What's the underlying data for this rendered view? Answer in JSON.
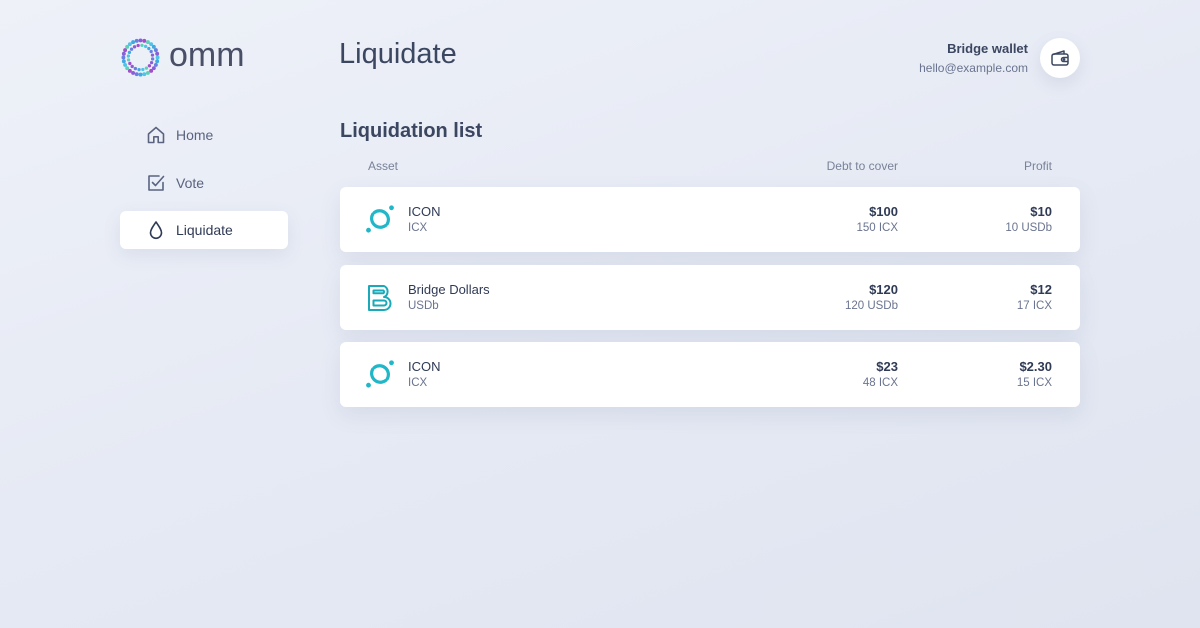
{
  "brand": {
    "name": "omm",
    "logo_icon": "omm-dotted-ring-logo"
  },
  "sidebar": {
    "items": [
      {
        "label": "Home",
        "icon": "home-icon",
        "active": false
      },
      {
        "label": "Vote",
        "icon": "checkbox-icon",
        "active": false
      },
      {
        "label": "Liquidate",
        "icon": "drop-icon",
        "active": true
      }
    ]
  },
  "header": {
    "title": "Liquidate",
    "wallet": {
      "name": "Bridge wallet",
      "email": "hello@example.com",
      "icon": "wallet-icon"
    }
  },
  "list": {
    "title": "Liquidation list",
    "columns": {
      "asset": "Asset",
      "debt": "Debt to cover",
      "profit": "Profit"
    },
    "rows": [
      {
        "name": "ICON",
        "ticker": "ICX",
        "icon": "icon-network-icon",
        "debt_usd": "$100",
        "debt_amount": "150 ICX",
        "profit_usd": "$10",
        "profit_amount": "10 USDb"
      },
      {
        "name": "Bridge Dollars",
        "ticker": "USDb",
        "icon": "bridge-dollars-icon",
        "debt_usd": "$120",
        "debt_amount": "120 USDb",
        "profit_usd": "$12",
        "profit_amount": "17 ICX"
      },
      {
        "name": "ICON",
        "ticker": "ICX",
        "icon": "icon-network-icon",
        "debt_usd": "$23",
        "debt_amount": "48 ICX",
        "profit_usd": "$2.30",
        "profit_amount": "15 ICX"
      }
    ]
  },
  "colors": {
    "accent": "#20b7c9",
    "text": "#3b4660",
    "muted": "#6a7490",
    "background": "#e6eaf4"
  }
}
